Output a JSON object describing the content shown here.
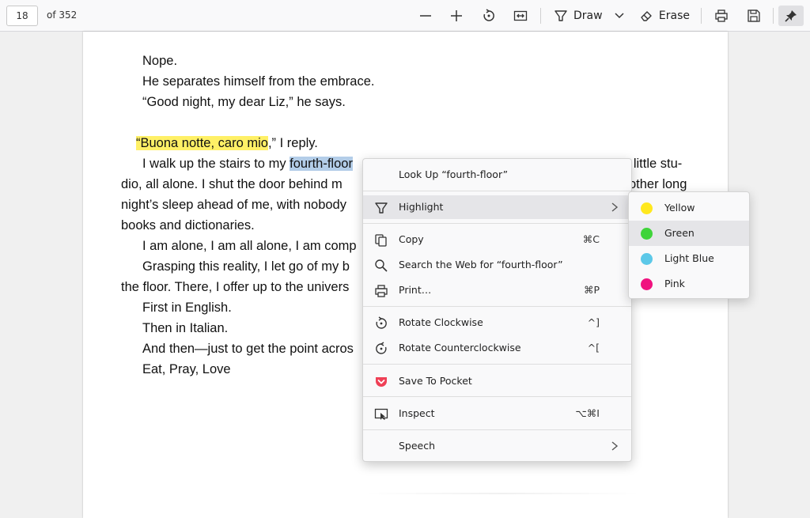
{
  "toolbar": {
    "page_number": "18",
    "page_count": "of 352",
    "draw_label": "Draw",
    "erase_label": "Erase"
  },
  "document": {
    "lines": [
      "Nope.",
      "He separates himself from the embrace.",
      "“Good night, my dear Liz,” he says.",
      "“Buona notte, caro mio",
      ",” I reply.",
      "I walk up the stairs to my ",
      "fourth-floor",
      "y little stu-",
      "dio, all alone. I shut the door behind m",
      "other long",
      "night’s sleep ahead of me, with nobody",
      "books and dictionaries.",
      "I am alone, I am all alone, I am comp",
      "Grasping this reality, I let go of my b",
      "the floor. There, I offer up to the univers",
      "First in English.",
      "Then in Italian.",
      "And then—just to get the point acros",
      "Eat, Pray, Love"
    ]
  },
  "context_menu": {
    "look_up": "Look Up “fourth-floor”",
    "highlight": "Highlight",
    "copy": "Copy",
    "copy_shortcut": "⌘C",
    "search_web": "Search the Web for “fourth-floor”",
    "print": "Print…",
    "print_shortcut": "⌘P",
    "rotate_cw": "Rotate Clockwise",
    "rotate_cw_shortcut": "^]",
    "rotate_ccw": "Rotate Counterclockwise",
    "rotate_ccw_shortcut": "^[",
    "save_pocket": "Save To Pocket",
    "inspect": "Inspect",
    "inspect_shortcut": "⌥⌘I",
    "speech": "Speech"
  },
  "highlight_submenu": {
    "items": [
      {
        "label": "Yellow",
        "color": "#ffe81f"
      },
      {
        "label": "Green",
        "color": "#3fd43a"
      },
      {
        "label": "Light Blue",
        "color": "#5cc8e8"
      },
      {
        "label": "Pink",
        "color": "#f0127f"
      }
    ],
    "hovered": "Green"
  },
  "colors": {
    "yellow_highlight": "#fff066",
    "selection_blue": "#b3cde8",
    "pocket_red": "#ef4056"
  }
}
